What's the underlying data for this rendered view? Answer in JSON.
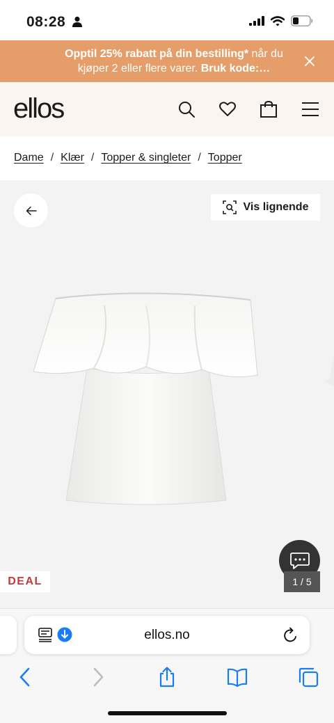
{
  "status_bar": {
    "time": "08:28",
    "icons": [
      "person-icon",
      "signal-icon",
      "wifi-icon",
      "battery-icon"
    ]
  },
  "promo": {
    "bold_part": "Opptil 25% rabatt på din bestilling*",
    "normal_part": " når du kjøper 2 eller flere varer. ",
    "code_label": "Bruk kode:…",
    "background_color": "#e59e6a"
  },
  "header": {
    "logo": "ellos",
    "icons": [
      "search-icon",
      "heart-icon",
      "shopping-bag-icon",
      "menu-icon"
    ]
  },
  "breadcrumb": {
    "items": [
      "Dame",
      "Klær",
      "Topper & singleter",
      "Topper"
    ],
    "separator": "/"
  },
  "gallery": {
    "similar_label": "Vis lignende",
    "deal_label": "DEAL",
    "counter": "1 / 5",
    "deal_color": "#c0393b"
  },
  "browser": {
    "url": "ellos.no",
    "toolbar": [
      "back-icon",
      "forward-icon",
      "share-icon",
      "bookmarks-icon",
      "tabs-icon"
    ],
    "accent_color": "#1a7cf2"
  }
}
